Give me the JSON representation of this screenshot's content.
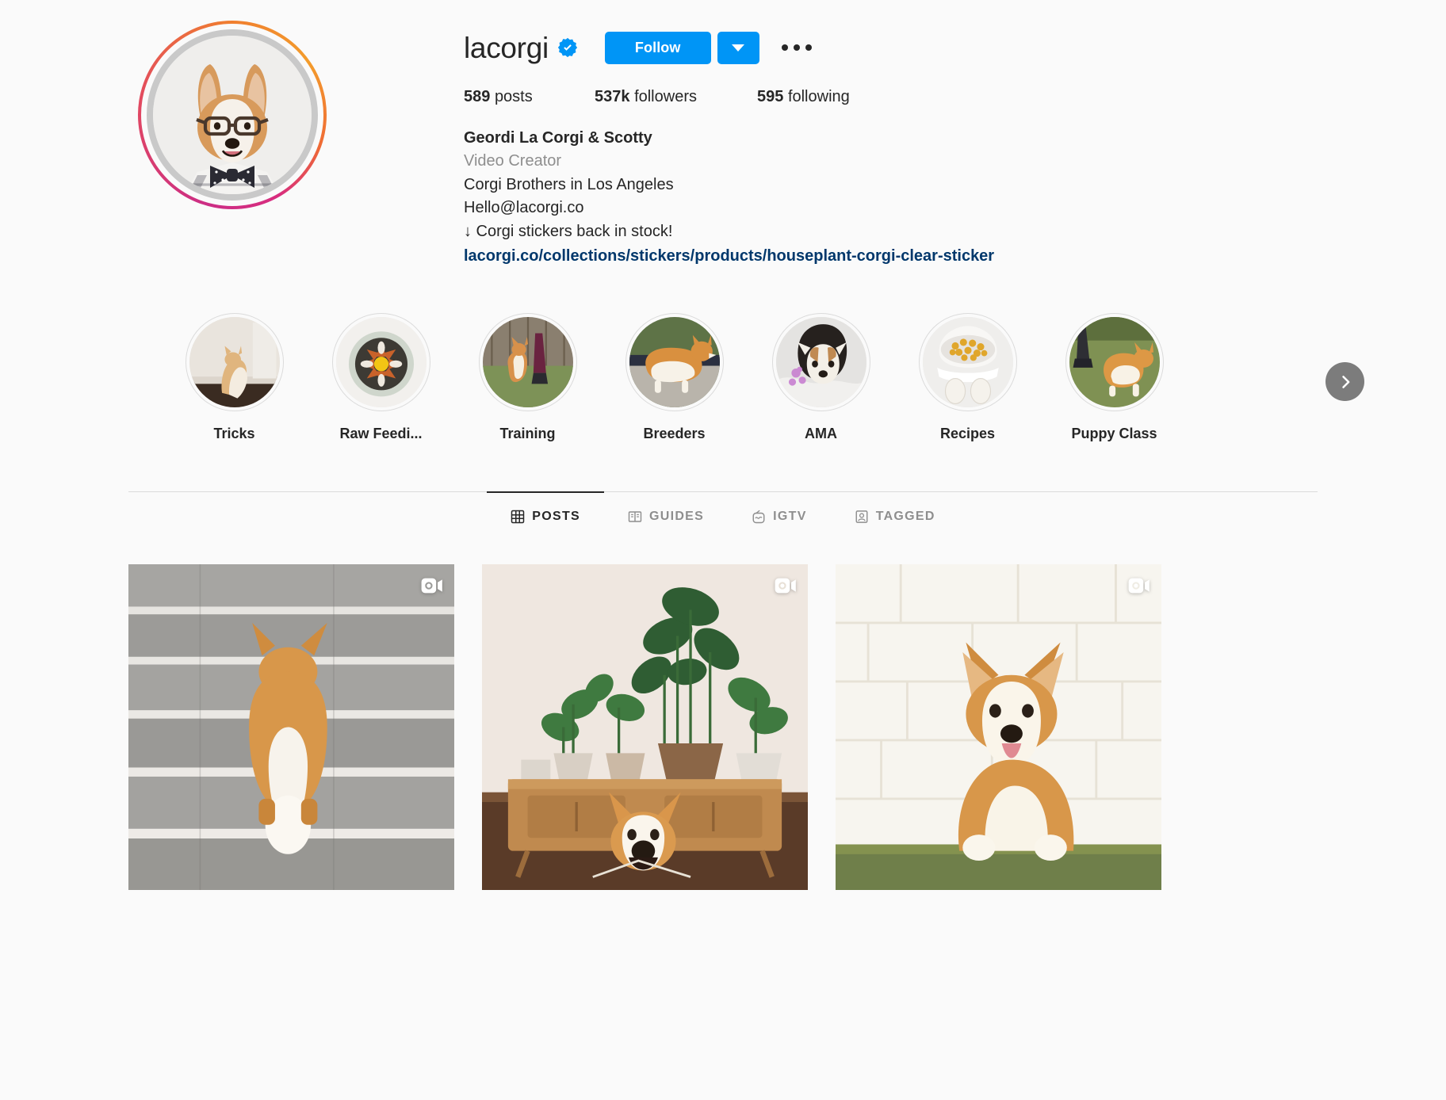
{
  "profile": {
    "username": "lacorgi",
    "verified": true,
    "verified_icon": "verified-badge-icon",
    "follow_label": "Follow",
    "dropdown_icon": "chevron-down-icon",
    "more_icon": "more-options-icon",
    "avatar_alt": "corgi-with-glasses-avatar",
    "has_story_ring": true,
    "stats": {
      "posts_value": "589",
      "posts_label": "posts",
      "followers_value": "537k",
      "followers_label": "followers",
      "following_value": "595",
      "following_label": "following"
    },
    "bio": {
      "full_name": "Geordi La Corgi & Scotty",
      "category": "Video Creator",
      "line1": "Corgi Brothers in Los Angeles",
      "line2": "Hello@lacorgi.co",
      "line3": "↓ Corgi stickers back in stock!",
      "link": "lacorgi.co/collections/stickers/products/houseplant-corgi-clear-sticker"
    }
  },
  "highlights": {
    "next_icon": "chevron-right-icon",
    "items": [
      {
        "label": "Tricks",
        "art": "corgi-standing-indoors"
      },
      {
        "label": "Raw Feedi...",
        "art": "raw-food-bowl"
      },
      {
        "label": "Training",
        "art": "corgi-training-grass"
      },
      {
        "label": "Breeders",
        "art": "corgi-side-profile"
      },
      {
        "label": "AMA",
        "art": "puppy-on-blanket"
      },
      {
        "label": "Recipes",
        "art": "kibble-bowl-paws"
      },
      {
        "label": "Puppy Class",
        "art": "corgi-running-grass"
      }
    ]
  },
  "tabs": [
    {
      "label": "POSTS",
      "icon": "grid-icon",
      "active": true
    },
    {
      "label": "GUIDES",
      "icon": "book-icon",
      "active": false
    },
    {
      "label": "IGTV",
      "icon": "igtv-icon",
      "active": false
    },
    {
      "label": "TAGGED",
      "icon": "tagged-person-icon",
      "active": false
    }
  ],
  "posts": [
    {
      "art": "corgi-climbing-concrete-stairs",
      "is_video": true,
      "video_icon": "video-camera-icon"
    },
    {
      "art": "corgi-barking-by-plant-console",
      "is_video": true,
      "video_icon": "video-camera-icon"
    },
    {
      "art": "corgi-sitting-by-white-brick-wall",
      "is_video": true,
      "video_icon": "video-camera-icon"
    }
  ],
  "colors": {
    "background": "#fafafa",
    "primary_text": "#262626",
    "secondary_text": "#8e8e8e",
    "accent_blue": "#0095f6",
    "link_blue": "#00376b",
    "border": "#dbdbdb"
  }
}
